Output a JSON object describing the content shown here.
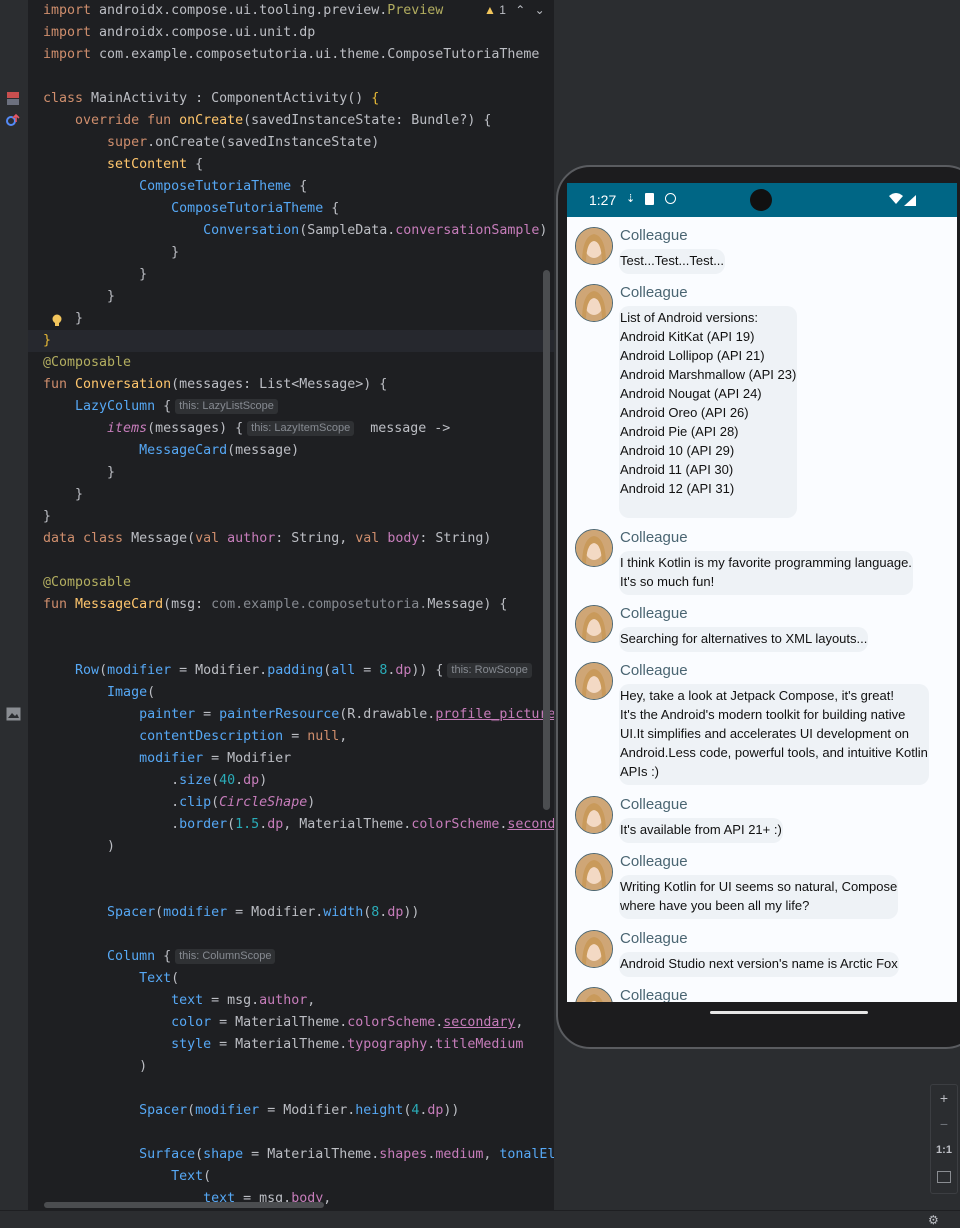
{
  "editor": {
    "warning_count": "1",
    "lines": [
      "import androidx.compose.ui.tooling.preview.Preview",
      "import androidx.compose.ui.unit.dp",
      "import com.example.composetutoria.ui.theme.ComposeTutoriaTheme",
      "",
      "class MainActivity : ComponentActivity() {",
      "    override fun onCreate(savedInstanceState: Bundle?) {",
      "        super.onCreate(savedInstanceState)",
      "        setContent {",
      "            ComposeTutoriaTheme {",
      "                ComposeTutoriaTheme {",
      "                    Conversation(SampleData.conversationSample)",
      "                }",
      "            }",
      "        }",
      "    }",
      "}",
      "@Composable",
      "fun Conversation(messages: List<Message>) {",
      "    LazyColumn {",
      "        items(messages) {  message ->",
      "            MessageCard(message)",
      "        }",
      "    }",
      "}",
      "data class Message(val author: String, val body: String)",
      "",
      "@Composable",
      "fun MessageCard(msg: com.example.composetutoria.Message) {",
      "",
      "",
      "    Row(modifier = Modifier.padding(all = 8.dp)) {",
      "        Image(",
      "            painter = painterResource(R.drawable.profile_picture",
      "            contentDescription = null,",
      "            modifier = Modifier",
      "                .size(40.dp)",
      "                .clip(CircleShape)",
      "                .border(1.5.dp, MaterialTheme.colorScheme.second",
      "        )",
      "",
      "",
      "        Spacer(modifier = Modifier.width(8.dp))",
      "",
      "        Column {",
      "            Text(",
      "                text = msg.author,",
      "                color = MaterialTheme.colorScheme.secondary,",
      "                style = MaterialTheme.typography.titleMedium",
      "            )",
      "",
      "            Spacer(modifier = Modifier.height(4.dp))",
      "",
      "            Surface(shape = MaterialTheme.shapes.medium, tonalEl",
      "                Text(",
      "                    text = msg.body,"
    ],
    "hints": {
      "lazy_column": "this: LazyListScope",
      "items": "this: LazyItemScope",
      "row": "this: RowScope",
      "column": "this: ColumnScope"
    }
  },
  "phone": {
    "time": "1:27",
    "messages": [
      {
        "author": "Colleague",
        "body": "Test...Test...Test..."
      },
      {
        "author": "Colleague",
        "body": "List of Android versions:\nAndroid KitKat (API 19)\nAndroid Lollipop (API 21)\nAndroid Marshmallow (API 23)\nAndroid Nougat (API 24)\nAndroid Oreo (API 26)\nAndroid Pie (API 28)\nAndroid 10 (API 29)\nAndroid 11 (API 30)\nAndroid 12 (API 31)"
      },
      {
        "author": "Colleague",
        "body": "I think Kotlin is my favorite programming language.\nIt's so much fun!"
      },
      {
        "author": "Colleague",
        "body": "Searching for alternatives to XML layouts..."
      },
      {
        "author": "Colleague",
        "body": "Hey, take a look at Jetpack Compose, it's great!\nIt's the Android's modern toolkit for building native\nUI.It simplifies and accelerates UI development on\nAndroid.Less code, powerful tools, and intuitive Kotlin\nAPIs :)"
      },
      {
        "author": "Colleague",
        "body": "It's available from API 21+ :)"
      },
      {
        "author": "Colleague",
        "body": "Writing Kotlin for UI seems so natural, Compose\nwhere have you been all my life?"
      },
      {
        "author": "Colleague",
        "body": "Android Studio next version's name is Arctic Fox"
      },
      {
        "author": "Colleague",
        "body": ""
      }
    ]
  },
  "zoom": {
    "plus": "+",
    "minus": "−",
    "one_to_one": "1:1"
  }
}
